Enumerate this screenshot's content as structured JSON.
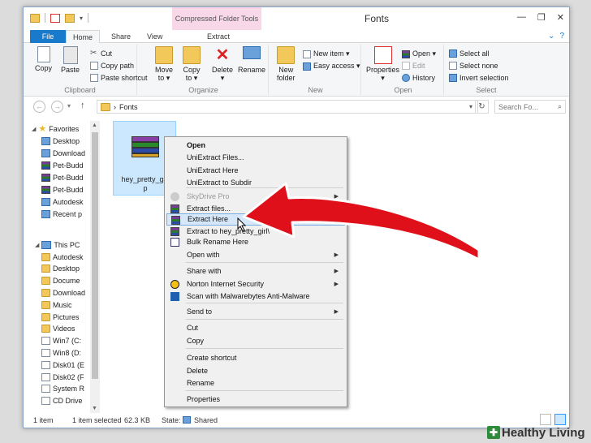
{
  "window": {
    "title": "Fonts",
    "context_tab": "Compressed Folder Tools",
    "buttons": [
      "—",
      "❐",
      "✕"
    ]
  },
  "tabs": {
    "file": "File",
    "home": "Home",
    "share": "Share",
    "view": "View",
    "extract": "Extract"
  },
  "ribbon": {
    "clipboard": {
      "label": "Clipboard",
      "copy": "Copy",
      "paste": "Paste",
      "cut": "Cut",
      "copy_path": "Copy path",
      "paste_shortcut": "Paste shortcut"
    },
    "organize": {
      "label": "Organize",
      "move_to": "Move",
      "move_to2": "to ▾",
      "copy_to": "Copy",
      "copy_to2": "to ▾",
      "delete": "Delete",
      "delete2": "▾",
      "rename": "Rename"
    },
    "new": {
      "label": "New",
      "new_folder": "New",
      "new_folder2": "folder",
      "new_item": "New item ▾",
      "easy_access": "Easy access ▾"
    },
    "open": {
      "label": "Open",
      "properties": "Properties",
      "properties2": "▾",
      "open": "Open ▾",
      "edit": "Edit",
      "history": "History"
    },
    "select": {
      "label": "Select",
      "select_all": "Select all",
      "select_none": "Select none",
      "invert_selection": "Invert selection"
    }
  },
  "address": {
    "back": "←",
    "forward": "→",
    "recent": "▾",
    "up": "↑",
    "separator": "›",
    "path": "Fonts",
    "dropdown": "▾",
    "refresh": "↻",
    "search_placeholder": "Search Fo...",
    "search_icon": "⌕"
  },
  "navpane": {
    "favorites": "Favorites",
    "fav_items": [
      "Desktop",
      "Download",
      "Pet-Budd",
      "Pet-Budd",
      "Pet-Budd",
      "Autodesk",
      "Recent p"
    ],
    "thispc": "This PC",
    "pc_items": [
      "Autodesk",
      "Desktop",
      "Docume",
      "Download",
      "Music",
      "Pictures",
      "Videos",
      "Win7 (C:",
      "Win8 (D:",
      "Disk01 (E",
      "Disk02 (F",
      "System R",
      "CD Drive"
    ]
  },
  "file": {
    "name": "hey_pretty_girl.rar",
    "name_display": "hey_pretty_girl\np"
  },
  "menu": {
    "items": [
      {
        "label": "Open",
        "bold": true
      },
      {
        "label": "UniExtract Files..."
      },
      {
        "label": "UniExtract Here"
      },
      {
        "label": "UniExtract to Subdir"
      },
      {
        "label": "SkyDrive Pro",
        "disabled": true,
        "submenu": true
      },
      {
        "label": "Extract files..."
      },
      {
        "label": "Extract Here",
        "highlight": true
      },
      {
        "label": "Extract to hey_pretty_girl\\"
      },
      {
        "label": "Bulk Rename Here"
      },
      {
        "label": "Open with",
        "submenu": true
      },
      {
        "label": "Share with",
        "submenu": true
      },
      {
        "label": "Norton Internet Security",
        "submenu": true
      },
      {
        "label": "Scan with Malwarebytes Anti-Malware"
      },
      {
        "label": "Send to",
        "submenu": true
      },
      {
        "label": "Cut"
      },
      {
        "label": "Copy"
      },
      {
        "label": "Create shortcut"
      },
      {
        "label": "Delete"
      },
      {
        "label": "Rename"
      },
      {
        "label": "Properties"
      }
    ],
    "arrow_glyph": "▶"
  },
  "status": {
    "count": "1 item",
    "selected": "1 item selected",
    "size": "62.3 KB",
    "state_label": "State:",
    "state_value": "Shared"
  },
  "watermark": {
    "text": "Healthy Living"
  },
  "colors": {
    "accent": "#1979ca",
    "arrow": "#e0101a",
    "selection": "#cce8ff"
  }
}
